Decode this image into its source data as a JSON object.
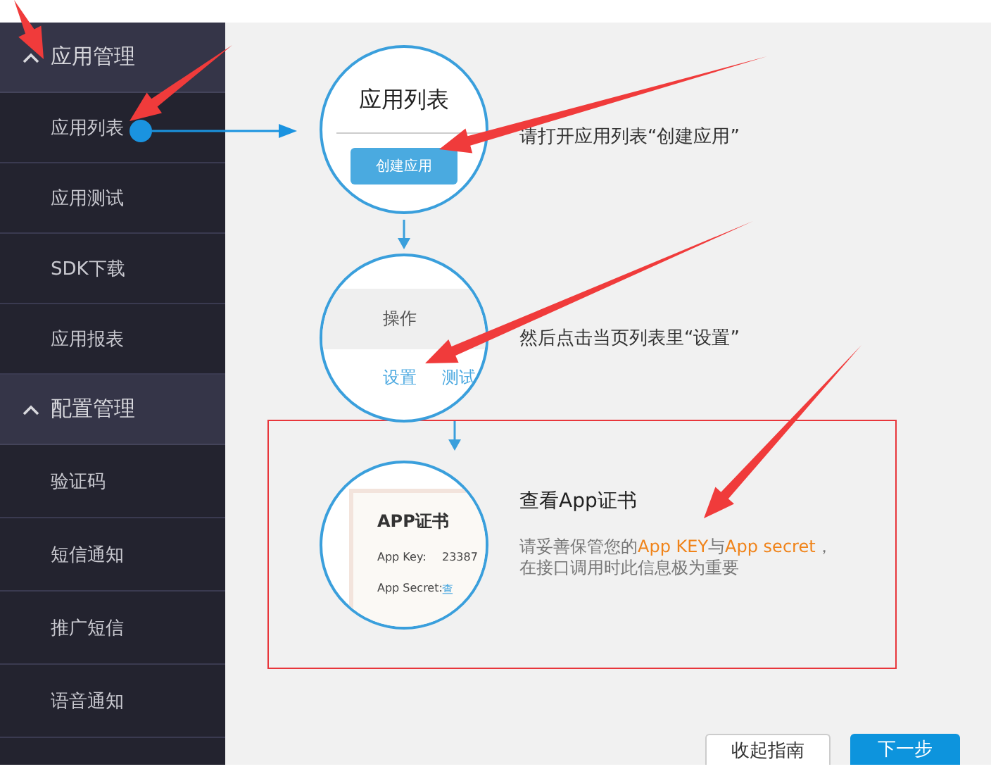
{
  "sidebar": {
    "groups": [
      {
        "title": "应用管理",
        "expanded": true,
        "items": [
          "应用列表",
          "应用测试",
          "SDK下载",
          "应用报表"
        ]
      },
      {
        "title": "配置管理",
        "expanded": true,
        "items": [
          "验证码",
          "短信通知",
          "推广短信",
          "语音通知"
        ]
      }
    ]
  },
  "guide": {
    "steps": [
      {
        "kind": "list",
        "circle": {
          "title": "应用列表",
          "button": "创建应用"
        },
        "text": "请打开应用列表“创建应用”"
      },
      {
        "kind": "table",
        "circle": {
          "header": "操作",
          "links": [
            "设置",
            "测试"
          ]
        },
        "text": "然后点击当页列表里“设置”"
      },
      {
        "kind": "cert",
        "circle": {
          "title": "APP证书",
          "rows": [
            {
              "label": "App Key:",
              "value": "23387"
            },
            {
              "label": "App Secret:",
              "value": "查"
            }
          ]
        },
        "title": "查看App证书",
        "lines": [
          [
            {
              "text": "请妥善保管您的",
              "highlight": false
            },
            {
              "text": "App KEY",
              "highlight": true
            },
            {
              "text": "与",
              "highlight": false
            },
            {
              "text": "App secret",
              "highlight": true
            },
            {
              "text": "，",
              "highlight": false
            }
          ],
          [
            {
              "text": "在接口调用时此信息极为重要",
              "highlight": false
            }
          ]
        ]
      }
    ]
  },
  "buttons": [
    {
      "label": "收起指南",
      "kind": "secondary"
    },
    {
      "label": "下一步",
      "kind": "primary"
    }
  ]
}
